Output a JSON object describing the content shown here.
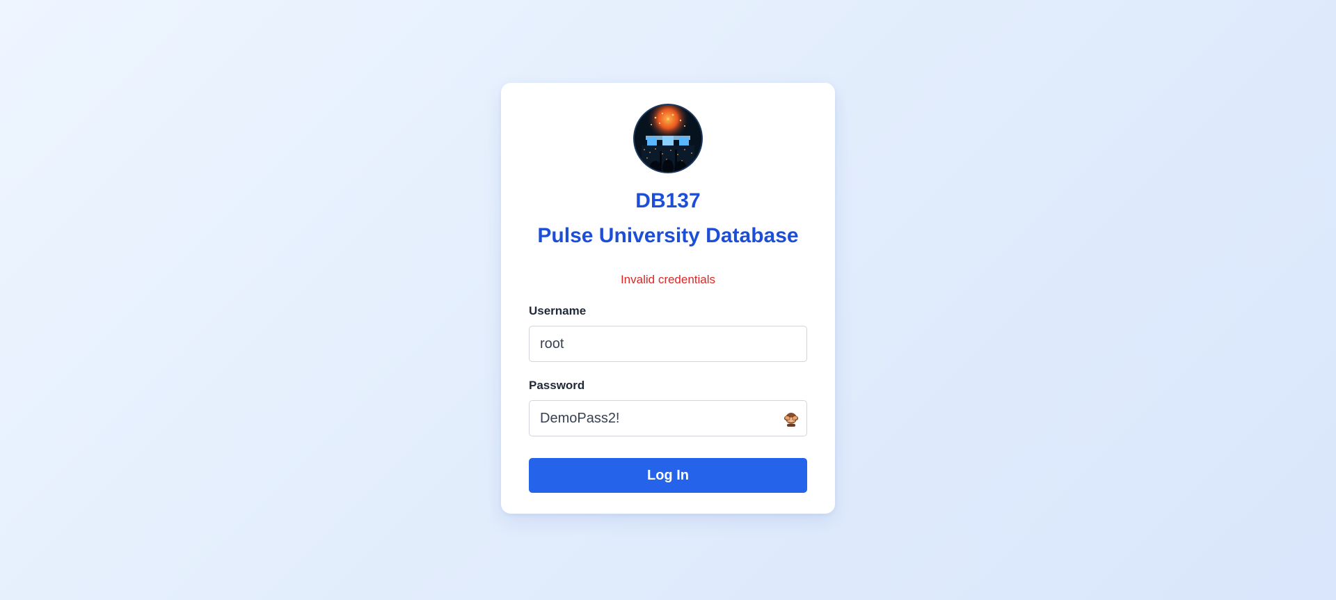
{
  "brand": {
    "code": "DB137",
    "name": "Pulse University Database"
  },
  "logo_icon": "concert-crowd-avatar",
  "error_message": "Invalid credentials",
  "form": {
    "username_label": "Username",
    "username_value": "root",
    "password_label": "Password",
    "password_value": "DemoPass2!",
    "password_toggle_icon": "see-no-evil-monkey-icon",
    "submit_label": "Log In"
  },
  "colors": {
    "accent": "#2563eb",
    "title": "#1d4ed8",
    "error": "#dc2626"
  }
}
